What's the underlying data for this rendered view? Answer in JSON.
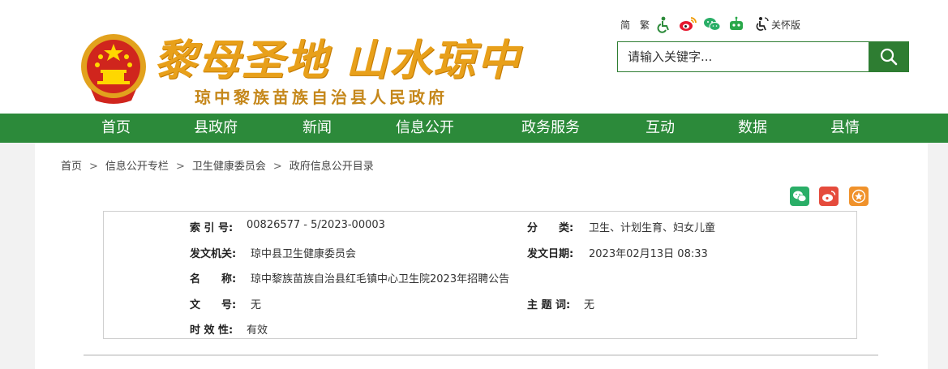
{
  "header": {
    "slogan": "黎母圣地 山水琼中",
    "gov_name": "琼中黎族苗族自治县人民政府",
    "toolbar": {
      "simplified": "简",
      "traditional": "繁",
      "accessible_label": "关怀版",
      "icons": [
        "accessibility-icon",
        "weibo-icon",
        "wechat-icon",
        "robot-icon",
        "elderly-care-icon"
      ]
    },
    "search": {
      "placeholder": "请输入关键字..."
    }
  },
  "nav": {
    "items": [
      {
        "label": "首页"
      },
      {
        "label": "县政府"
      },
      {
        "label": "新闻"
      },
      {
        "label": "信息公开"
      },
      {
        "label": "政务服务"
      },
      {
        "label": "互动"
      },
      {
        "label": "数据"
      },
      {
        "label": "县情"
      }
    ]
  },
  "breadcrumb": {
    "items": [
      "首页",
      "信息公开专栏",
      "卫生健康委员会",
      "政府信息公开目录"
    ],
    "separator": ">"
  },
  "share": {
    "icons": [
      "wechat-share-icon",
      "weibo-share-icon",
      "favorite-icon"
    ]
  },
  "meta": {
    "index_label": "索 引 号:",
    "index_value": "00826577 - 5/2023-00003",
    "category_label": "分　　类:",
    "category_value": "卫生、计划生育、妇女儿童",
    "issuer_label": "发文机关:",
    "issuer_value": "琼中县卫生健康委员会",
    "date_label": "发文日期:",
    "date_value": "2023年02月13日 08:33",
    "name_label": "名　　称:",
    "name_value": "琼中黎族苗族自治县红毛镇中心卫生院2023年招聘公告",
    "docno_label": "文　　号:",
    "docno_value": "无",
    "keywords_label": "主 题 词:",
    "keywords_value": "无",
    "validity_label": "时 效 性:",
    "validity_value": "有效"
  },
  "colors": {
    "brand_green": "#2c8a3a",
    "slogan_gold": "#e8a01a",
    "emblem_red": "#d0251d"
  }
}
